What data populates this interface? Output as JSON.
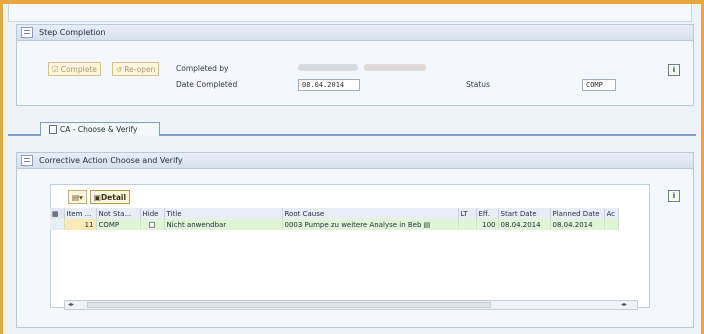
{
  "step_panel": {
    "title": "Step Completion",
    "complete_label": "Complete",
    "reopen_label": "Re-open",
    "completed_by_label": "Completed by",
    "date_completed_label": "Date Completed",
    "date_completed_value": "08.04.2014",
    "status_label": "Status",
    "status_value": "COMP"
  },
  "tabs": [
    {
      "label": "CA - Choose & Verify"
    }
  ],
  "ca_panel": {
    "title": "Corrective Action Choose and Verify",
    "detail_label": "Detail"
  },
  "table": {
    "columns": [
      "Item ...",
      "Not Sta...",
      "Hide",
      "Title",
      "Root Cause",
      "LT",
      "Eff.",
      "Start Date",
      "Planned Date",
      "Ac"
    ],
    "rows": [
      {
        "item": "11",
        "not_status": "COMP",
        "title": "Nicht anwendbar",
        "root_cause": "0003 Pumpe zu weitere Analyse in Beb",
        "lt": "",
        "eff": "100",
        "start_date": "08.04.2014",
        "planned_date": "08.04.2014"
      }
    ]
  },
  "colors": {
    "frame_border": "#e8a640",
    "row_highlight": "#dff5d5",
    "item_cell": "#fde9b5"
  }
}
